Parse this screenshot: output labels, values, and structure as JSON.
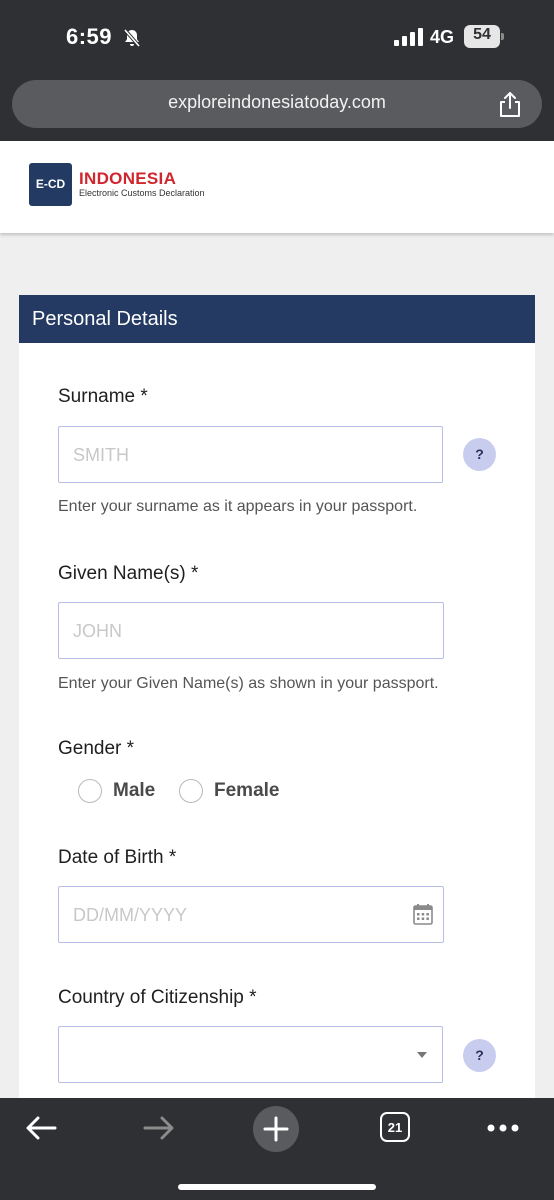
{
  "status_bar": {
    "time": "6:59",
    "network": "4G",
    "battery": "54"
  },
  "browser": {
    "url": "exploreindonesiatoday.com",
    "tab_count": "21"
  },
  "site": {
    "logo_abbr": "E-CD",
    "logo_title": "INDONESIA",
    "logo_subtitle": "Electronic Customs Declaration"
  },
  "form": {
    "section_title": "Personal Details",
    "surname": {
      "label": "Surname *",
      "placeholder": "SMITH",
      "help": "Enter your surname as it appears in your passport."
    },
    "given_names": {
      "label": "Given Name(s) *",
      "placeholder": "JOHN",
      "help": "Enter your Given Name(s) as shown in your passport."
    },
    "gender": {
      "label": "Gender *",
      "options": [
        "Male",
        "Female"
      ]
    },
    "dob": {
      "label": "Date of Birth *",
      "placeholder": "DD/MM/YYYY"
    },
    "citizenship": {
      "label": "Country of Citizenship *",
      "value": ""
    },
    "help_button": "?"
  },
  "colors": {
    "header_navy": "#243a62",
    "logo_red": "#d0262d",
    "help_circle": "#c8cdf0",
    "input_border": "#b8bde6"
  },
  "icons": [
    "bell-slash-icon",
    "signal-icon",
    "battery-icon",
    "share-icon",
    "calendar-icon",
    "chevron-down-icon",
    "back-arrow-icon",
    "forward-arrow-icon",
    "new-tab-plus-icon",
    "tabs-count-icon",
    "more-dots-icon"
  ]
}
